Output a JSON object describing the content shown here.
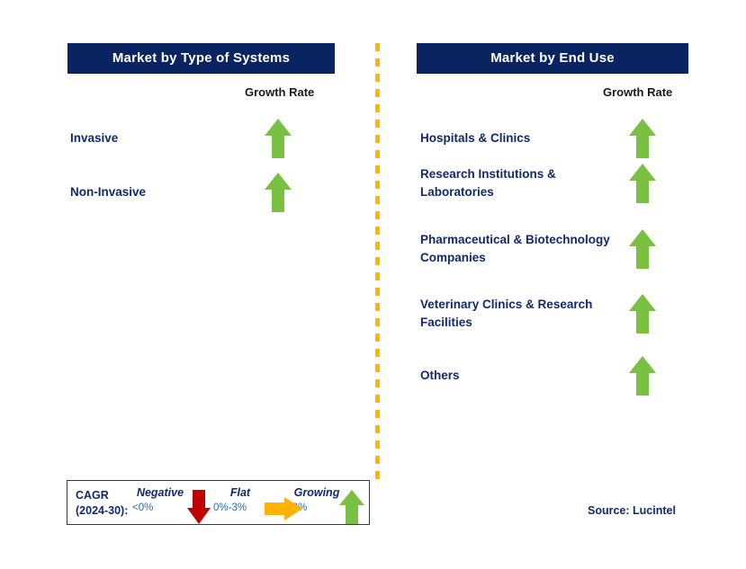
{
  "panels": [
    {
      "title": "Market by Type of Systems",
      "growth_rate_label": "Growth Rate",
      "items": [
        {
          "label": "Invasive",
          "growth": "up"
        },
        {
          "label": "Non-Invasive",
          "growth": "up"
        }
      ]
    },
    {
      "title": "Market by End Use",
      "growth_rate_label": "Growth Rate",
      "items": [
        {
          "label": "Hospitals & Clinics",
          "growth": "up"
        },
        {
          "label": "Research Institutions & Laboratories",
          "growth": "up"
        },
        {
          "label": "Pharmaceutical & Biotechnology Companies",
          "growth": "up"
        },
        {
          "label": "Veterinary Clinics & Research Facilities",
          "growth": "up"
        },
        {
          "label": "Others",
          "growth": "up"
        }
      ]
    }
  ],
  "legend": {
    "title_line1": "CAGR",
    "title_line2": "(2024-30):",
    "entries": [
      {
        "word": "Negative",
        "range": "<0%",
        "icon": "arrow-down-icon",
        "color": "#C00000"
      },
      {
        "word": "Flat",
        "range": "0%-3%",
        "icon": "arrow-right-icon",
        "color": "#FFB300"
      },
      {
        "word": "Growing",
        "range": ">3%",
        "icon": "arrow-up-icon",
        "color": "#7AC143"
      }
    ]
  },
  "source": "Source: Lucintel",
  "colors": {
    "header_navy": "#0A2461",
    "text_navy": "#12296B",
    "growth_green": "#7AC143",
    "negative_red": "#C00000",
    "flat_orange": "#FFB300",
    "divider_amber": "#FFB600",
    "range_blue": "#2E6DA4"
  }
}
